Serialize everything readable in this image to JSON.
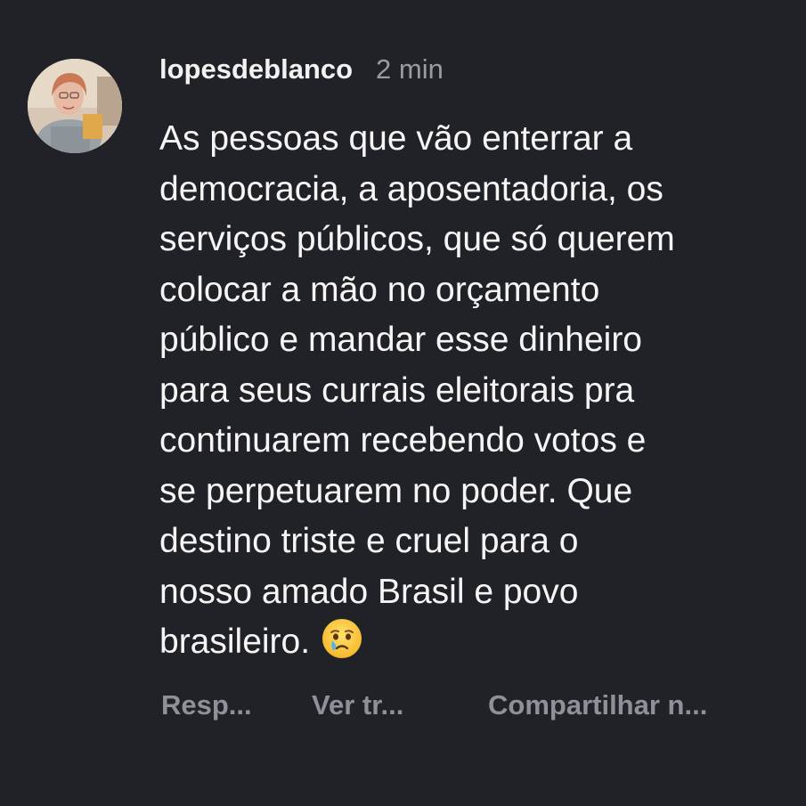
{
  "comment": {
    "username": "lopesdeblanco",
    "timestamp": "2 min",
    "lines": [
      "As pessoas que vão enterrar a",
      "democracia, a aposentadoria, os",
      "serviços públicos, que só querem",
      "colocar a mão no orçamento",
      "público e mandar esse dinheiro",
      "para seus currais eleitorais pra",
      "continuarem recebendo votos e",
      "se perpetuarem no poder. Que",
      "destino triste e cruel para o",
      "nosso amado Brasil e povo",
      "brasileiro."
    ],
    "emoji": "crying-face-emoji"
  },
  "actions": {
    "reply_label": "Resp...",
    "translate_label": "Ver tr...",
    "share_label": "Compartilhar n..."
  },
  "colors": {
    "background": "#212227",
    "text": "#f5f5f5",
    "muted": "#9a9ca3"
  }
}
